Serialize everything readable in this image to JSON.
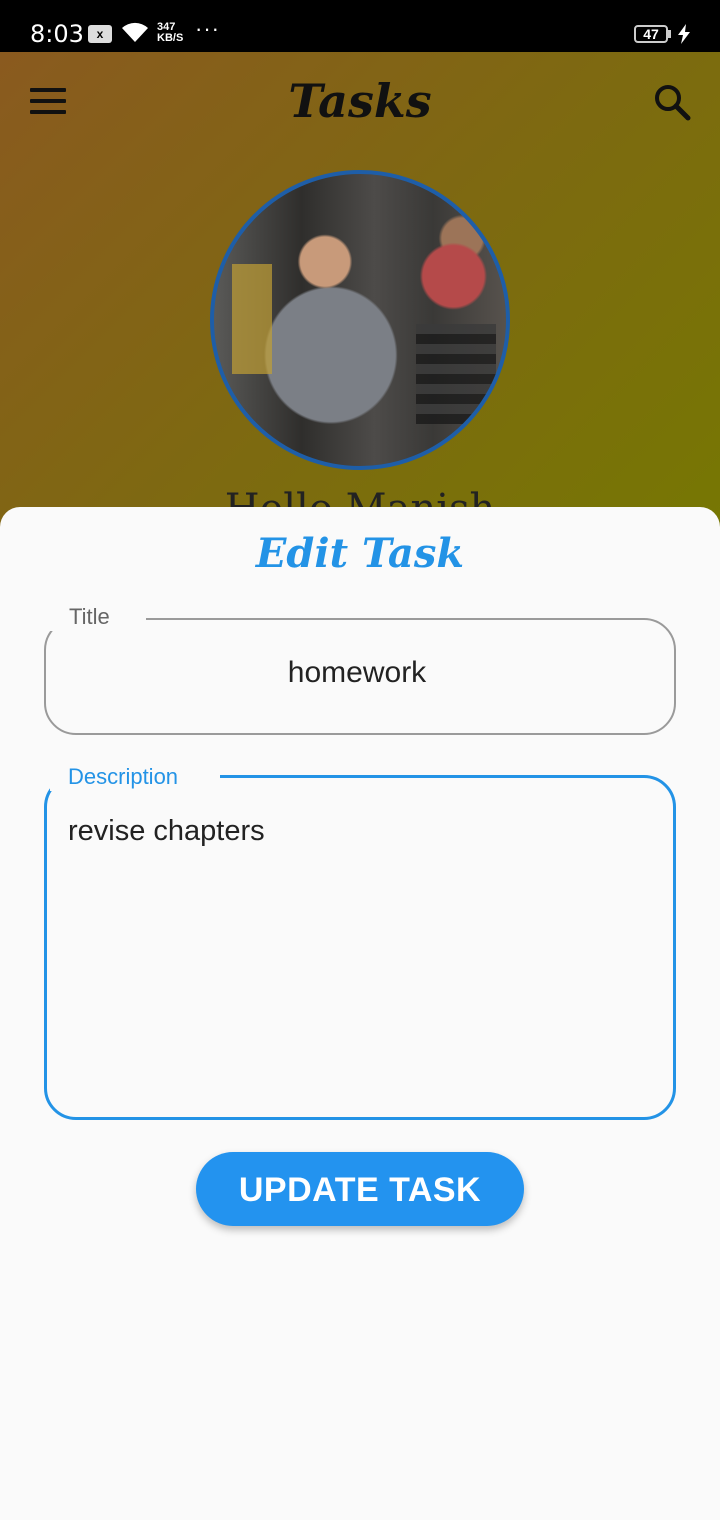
{
  "status_bar": {
    "time": "8:03",
    "notification_icon": "x",
    "net_speed_value": "347",
    "net_speed_unit": "KB/S",
    "overflow": "···",
    "battery": "47"
  },
  "app_bar": {
    "title": "Tasks",
    "menu_icon": "hamburger-icon",
    "search_icon": "search-icon"
  },
  "profile": {
    "greeting_partial": "Hello Manish"
  },
  "edit_sheet": {
    "title": "Edit Task",
    "title_field": {
      "label": "Title",
      "value": "homework"
    },
    "description_field": {
      "label": "Description",
      "value": "revise chapters"
    },
    "submit_label": "UPDATE TASK"
  },
  "colors": {
    "accent": "#2393e6",
    "avatar_border": "#1e5ea8",
    "sheet_bg": "#fafafa"
  }
}
